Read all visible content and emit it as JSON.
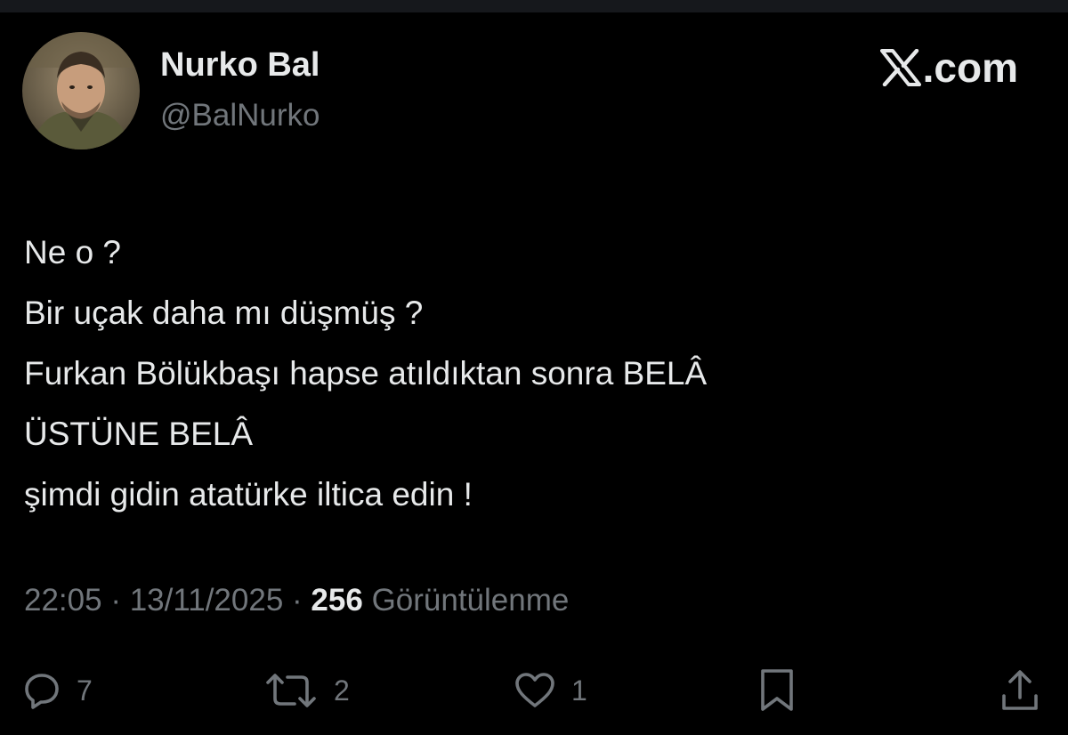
{
  "author": {
    "display_name": "Nurko Bal",
    "handle": "@BalNurko"
  },
  "brand": {
    "text": ".com",
    "icon": "x-logo-icon"
  },
  "tweet": {
    "lines": [
      "Ne o ?",
      "Bir uçak daha mı düşmüş ?",
      "Furkan Bölükbaşı hapse atıldıktan sonra BELÂ",
      "ÜSTÜNE BELÂ",
      "şimdi gidin atatürke iltica edin !"
    ]
  },
  "meta": {
    "time": "22:05",
    "separator": "·",
    "date": "13/11/2025",
    "views_count": "256",
    "views_label": "Görüntülenme"
  },
  "actions": {
    "reply": {
      "icon": "reply-icon",
      "count": "7"
    },
    "retweet": {
      "icon": "retweet-icon",
      "count": "2"
    },
    "like": {
      "icon": "heart-icon",
      "count": "1"
    },
    "bookmark": {
      "icon": "bookmark-icon"
    },
    "share": {
      "icon": "share-icon"
    }
  },
  "colors": {
    "background": "#000000",
    "primary_text": "#e7e9ea",
    "secondary_text": "#71767b"
  }
}
